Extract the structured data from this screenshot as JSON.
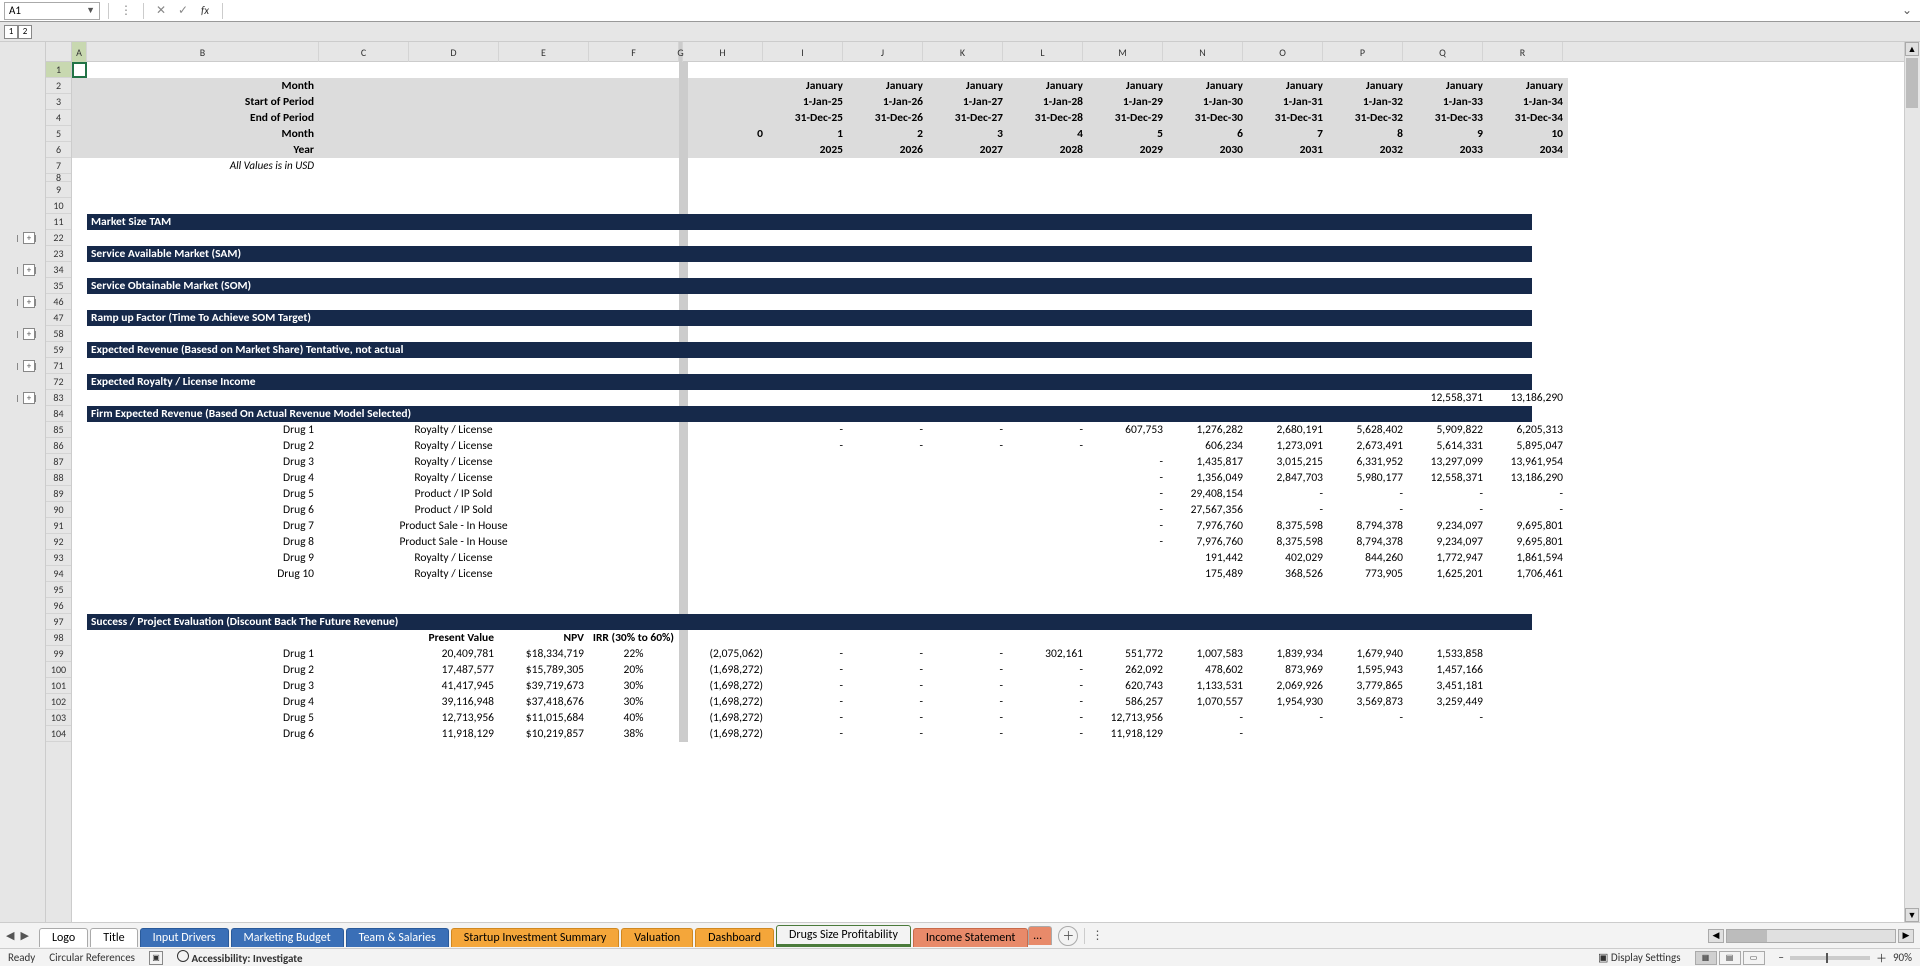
{
  "name_box": "A1",
  "outline_levels": [
    "1",
    "2"
  ],
  "col_letters": [
    "A",
    "B",
    "C",
    "D",
    "E",
    "F",
    "G",
    "H",
    "I",
    "J",
    "K",
    "L",
    "M",
    "N",
    "O",
    "P",
    "Q",
    "R"
  ],
  "col_widths": [
    "wA",
    "wB",
    "wC",
    "wD",
    "wE",
    "wF",
    "wG",
    "wH",
    "wI",
    "wJ",
    "wK",
    "wL",
    "wM",
    "wN",
    "wO",
    "wP",
    "wQ",
    "wR"
  ],
  "header_rows": {
    "labels": {
      "month": "Month",
      "sop": "Start of Period",
      "eop": "End of Period",
      "month2": "Month",
      "year": "Year",
      "note": "All Values is in USD"
    },
    "months": [
      "January",
      "January",
      "January",
      "January",
      "January",
      "January",
      "January",
      "January",
      "January",
      "January"
    ],
    "sop_vals": [
      "1-Jan-25",
      "1-Jan-26",
      "1-Jan-27",
      "1-Jan-28",
      "1-Jan-29",
      "1-Jan-30",
      "1-Jan-31",
      "1-Jan-32",
      "1-Jan-33",
      "1-Jan-34"
    ],
    "eop_vals": [
      "31-Dec-25",
      "31-Dec-26",
      "31-Dec-27",
      "31-Dec-28",
      "31-Dec-29",
      "31-Dec-30",
      "31-Dec-31",
      "31-Dec-32",
      "31-Dec-33",
      "31-Dec-34"
    ],
    "month_idx": [
      "0",
      "1",
      "2",
      "3",
      "4",
      "5",
      "6",
      "7",
      "8",
      "9",
      "10"
    ],
    "years": [
      "2025",
      "2026",
      "2027",
      "2028",
      "2029",
      "2030",
      "2031",
      "2032",
      "2033",
      "2034"
    ]
  },
  "sections": {
    "s11": "Market Size TAM",
    "s23": "Service Available Market (SAM)",
    "s35": "Service Obtainable Market (SOM)",
    "s47": "Ramp up Factor (Time To Achieve SOM Target)",
    "s59": "Expected Revenue (Basesd on Market Share) Tentative, not actual",
    "s72": "Expected Royalty / License Income",
    "s84": "Firm Expected Revenue (Based On Actual Revenue Model Selected)",
    "s97": "Success / Project Evaluation (Discount Back The Future Revenue)"
  },
  "row83": {
    "q": "12,558,371",
    "r": "13,186,290"
  },
  "revenue_rows": [
    {
      "n": "85",
      "drug": "Drug 1",
      "model": "Royalty / License",
      "v": [
        "-",
        "-",
        "-",
        "-",
        "607,753",
        "1,276,282",
        "2,680,191",
        "5,628,402",
        "5,909,822",
        "6,205,313"
      ]
    },
    {
      "n": "86",
      "drug": "Drug 2",
      "model": "Royalty / License",
      "v": [
        "-",
        "-",
        "-",
        "-",
        "",
        "606,234",
        "1,273,091",
        "2,673,491",
        "5,614,331",
        "5,895,047"
      ]
    },
    {
      "n": "87",
      "drug": "Drug 3",
      "model": "Royalty / License",
      "v": [
        "",
        "",
        "",
        "",
        "-",
        "1,435,817",
        "3,015,215",
        "6,331,952",
        "13,297,099",
        "13,961,954"
      ]
    },
    {
      "n": "88",
      "drug": "Drug 4",
      "model": "Royalty / License",
      "v": [
        "",
        "",
        "",
        "",
        "-",
        "1,356,049",
        "2,847,703",
        "5,980,177",
        "12,558,371",
        "13,186,290"
      ]
    },
    {
      "n": "89",
      "drug": "Drug 5",
      "model": "Product / IP Sold",
      "v": [
        "",
        "",
        "",
        "",
        "-",
        "29,408,154",
        "-",
        "-",
        "-",
        "-"
      ]
    },
    {
      "n": "90",
      "drug": "Drug 6",
      "model": "Product / IP Sold",
      "v": [
        "",
        "",
        "",
        "",
        "-",
        "27,567,356",
        "-",
        "-",
        "-",
        "-"
      ]
    },
    {
      "n": "91",
      "drug": "Drug 7",
      "model": "Product Sale - In House",
      "v": [
        "",
        "",
        "",
        "",
        "-",
        "7,976,760",
        "8,375,598",
        "8,794,378",
        "9,234,097",
        "9,695,801"
      ]
    },
    {
      "n": "92",
      "drug": "Drug 8",
      "model": "Product Sale - In House",
      "v": [
        "",
        "",
        "",
        "",
        "-",
        "7,976,760",
        "8,375,598",
        "8,794,378",
        "9,234,097",
        "9,695,801"
      ]
    },
    {
      "n": "93",
      "drug": "Drug 9",
      "model": "Royalty / License",
      "v": [
        "",
        "",
        "",
        "",
        "",
        "191,442",
        "402,029",
        "844,260",
        "1,772,947",
        "1,861,594"
      ]
    },
    {
      "n": "94",
      "drug": "Drug 10",
      "model": "Royalty / License",
      "v": [
        "",
        "",
        "",
        "",
        "",
        "175,489",
        "368,526",
        "773,905",
        "1,625,201",
        "1,706,461"
      ]
    }
  ],
  "eval_header": {
    "pv": "Present Value",
    "npv": "NPV",
    "irr": "IRR (30% to 60%)"
  },
  "eval_rows": [
    {
      "n": "99",
      "drug": "Drug 1",
      "pv": "20,409,781",
      "npv": "$18,334,719",
      "irr": "22%",
      "h": "(2,075,062)",
      "v": [
        "-",
        "-",
        "-",
        "302,161",
        "551,772",
        "1,007,583",
        "1,839,934",
        "1,679,940",
        "1,533,858"
      ]
    },
    {
      "n": "100",
      "drug": "Drug 2",
      "pv": "17,487,577",
      "npv": "$15,789,305",
      "irr": "20%",
      "h": "(1,698,272)",
      "v": [
        "-",
        "-",
        "-",
        "-",
        "262,092",
        "478,602",
        "873,969",
        "1,595,943",
        "1,457,166"
      ]
    },
    {
      "n": "101",
      "drug": "Drug 3",
      "pv": "41,417,945",
      "npv": "$39,719,673",
      "irr": "30%",
      "h": "(1,698,272)",
      "v": [
        "-",
        "-",
        "-",
        "-",
        "620,743",
        "1,133,531",
        "2,069,926",
        "3,779,865",
        "3,451,181"
      ]
    },
    {
      "n": "102",
      "drug": "Drug 4",
      "pv": "39,116,948",
      "npv": "$37,418,676",
      "irr": "30%",
      "h": "(1,698,272)",
      "v": [
        "-",
        "-",
        "-",
        "-",
        "586,257",
        "1,070,557",
        "1,954,930",
        "3,569,873",
        "3,259,449"
      ]
    },
    {
      "n": "103",
      "drug": "Drug 5",
      "pv": "12,713,956",
      "npv": "$11,015,684",
      "irr": "40%",
      "h": "(1,698,272)",
      "v": [
        "-",
        "-",
        "-",
        "-",
        "12,713,956",
        "-",
        "-",
        "-",
        "-"
      ]
    },
    {
      "n": "104",
      "drug": "Drug 6",
      "pv": "11,918,129",
      "npv": "$10,219,857",
      "irr": "38%",
      "h": "(1,698,272)",
      "v": [
        "-",
        "-",
        "-",
        "-",
        "11,918,129",
        "-",
        "",
        "",
        ""
      ]
    }
  ],
  "tabs": [
    {
      "t": "Logo",
      "c": ""
    },
    {
      "t": "Title",
      "c": ""
    },
    {
      "t": "Input Drivers",
      "c": "blue"
    },
    {
      "t": "Marketing Budget",
      "c": "blue"
    },
    {
      "t": "Team & Salaries",
      "c": "blue"
    },
    {
      "t": "Startup Investment Summary",
      "c": "orange"
    },
    {
      "t": "Valuation",
      "c": "orange"
    },
    {
      "t": "Dashboard",
      "c": "orange"
    },
    {
      "t": "Drugs Size Profitability",
      "c": "green-b"
    },
    {
      "t": "Income Statement",
      "c": "salmon"
    }
  ],
  "status": {
    "ready": "Ready",
    "circ": "Circular References",
    "acc": "Accessibility: Investigate",
    "disp": "Display Settings",
    "zoom": "90%"
  }
}
